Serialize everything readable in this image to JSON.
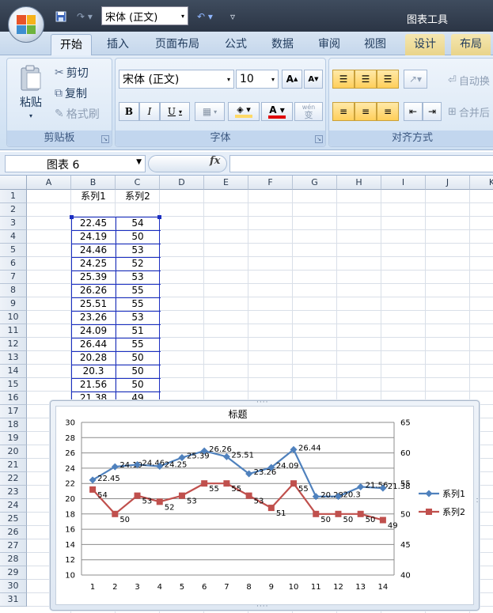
{
  "titlebar": {
    "qat_font": "宋体 (正文)",
    "context_title": "图表工具",
    "qat_icons": [
      "save-icon",
      "redo-icon",
      "undo-icon",
      "customize-icon"
    ]
  },
  "tabs": [
    {
      "label": "开始",
      "active": true
    },
    {
      "label": "插入"
    },
    {
      "label": "页面布局"
    },
    {
      "label": "公式"
    },
    {
      "label": "数据"
    },
    {
      "label": "审阅"
    },
    {
      "label": "视图"
    },
    {
      "label": "设计"
    },
    {
      "label": "布局"
    }
  ],
  "ribbon": {
    "clipboard": {
      "paste": "粘贴",
      "cut": "剪切",
      "copy": "复制",
      "format_painter": "格式刷",
      "label": "剪贴板"
    },
    "font": {
      "font_name": "宋体 (正文)",
      "font_size": "10",
      "bold": "B",
      "italic": "I",
      "underline": "U",
      "grow": "A",
      "shrink": "A",
      "wen": "wén",
      "wen_char": "变",
      "fill_color": "#ffd966",
      "font_color": "#e00000",
      "label": "字体"
    },
    "alignment": {
      "wrap": "自动换",
      "merge": "合并后",
      "label": "对齐方式"
    }
  },
  "formula_bar": {
    "name_box": "图表 6",
    "fx": "fx",
    "value": ""
  },
  "sheet": {
    "columns": [
      "A",
      "B",
      "C",
      "D",
      "E",
      "F",
      "G",
      "H",
      "I",
      "J",
      "K"
    ],
    "rows": [
      "1",
      "2",
      "3",
      "4",
      "5",
      "6",
      "7",
      "8",
      "9",
      "10",
      "11",
      "12",
      "13",
      "14",
      "15",
      "16",
      "17",
      "18",
      "19",
      "20",
      "21",
      "22",
      "23",
      "24",
      "25",
      "26",
      "27",
      "28",
      "29",
      "30",
      "31"
    ],
    "header": [
      "系列1",
      "系列2"
    ],
    "data": [
      [
        "22.45",
        "54"
      ],
      [
        "24.19",
        "50"
      ],
      [
        "24.46",
        "53"
      ],
      [
        "24.25",
        "52"
      ],
      [
        "25.39",
        "53"
      ],
      [
        "26.26",
        "55"
      ],
      [
        "25.51",
        "55"
      ],
      [
        "23.26",
        "53"
      ],
      [
        "24.09",
        "51"
      ],
      [
        "26.44",
        "55"
      ],
      [
        "20.28",
        "50"
      ],
      [
        "20.3",
        "50"
      ],
      [
        "21.56",
        "50"
      ],
      [
        "21.38",
        "49"
      ]
    ]
  },
  "chart_data": {
    "type": "line",
    "title": "标题",
    "categories": [
      1,
      2,
      3,
      4,
      5,
      6,
      7,
      8,
      9,
      10,
      11,
      12,
      13,
      14
    ],
    "series": [
      {
        "name": "系列1",
        "values": [
          22.45,
          24.19,
          24.46,
          24.25,
          25.39,
          26.26,
          25.51,
          23.26,
          24.09,
          26.44,
          20.28,
          20.3,
          21.56,
          21.38
        ],
        "color": "#4f81bd",
        "marker": "diamond",
        "axis": "primary"
      },
      {
        "name": "系列2",
        "values": [
          54,
          50,
          53,
          52,
          53,
          55,
          55,
          53,
          51,
          55,
          50,
          50,
          50,
          49
        ],
        "color": "#c0504d",
        "marker": "square",
        "axis": "secondary"
      }
    ],
    "y_primary": {
      "min": 10,
      "max": 30,
      "ticks": [
        10,
        12,
        14,
        16,
        18,
        20,
        22,
        24,
        26,
        28,
        30
      ]
    },
    "y_secondary": {
      "min": 40,
      "max": 65,
      "ticks": [
        40,
        45,
        50,
        55,
        60,
        65
      ]
    },
    "grid": true,
    "legend": "right",
    "data_labels": true
  }
}
